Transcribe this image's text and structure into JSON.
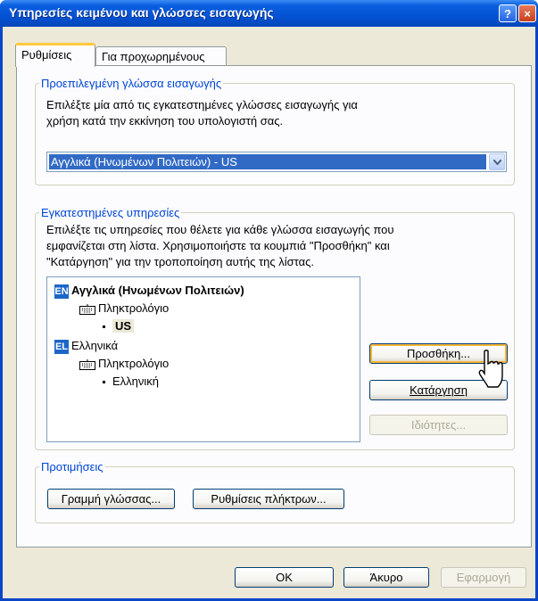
{
  "window": {
    "title": "Υπηρεσίες κειμένου και γλώσσες εισαγωγής",
    "help_label": "?",
    "close_label": "×"
  },
  "tabs": [
    {
      "label": "Ρυθμίσεις"
    },
    {
      "label": "Για προχωρημένους"
    }
  ],
  "default_language": {
    "legend": "Προεπιλεγμένη γλώσσα εισαγωγής",
    "description_line1": "Επιλέξτε μία από τις εγκατεστημένες γλώσσες εισαγωγής για",
    "description_line2": "χρήση κατά την εκκίνηση του υπολογιστή σας.",
    "selected_value": "Αγγλικά (Ηνωμένων Πολιτειών) - US"
  },
  "installed_services": {
    "legend": "Εγκατεστημένες υπηρεσίες",
    "description_line1": "Επιλέξτε τις υπηρεσίες που θέλετε για κάθε γλώσσα εισαγωγής που",
    "description_line2": "εμφανίζεται στη λίστα. Χρησιμοποιήστε τα κουμπιά \"Προσθήκη\" και",
    "description_line3": "\"Κατάργηση\" για την τροποποίηση αυτής της λίστας.",
    "tree": {
      "lang1": {
        "badge": "EN",
        "label": "Αγγλικά (Ηνωμένων Πολιτειών)",
        "category": "Πληκτρολόγιο",
        "layout": "US"
      },
      "lang2": {
        "badge": "EL",
        "label": "Ελληνικά",
        "category": "Πληκτρολόγιο",
        "layout": "Ελληνική"
      }
    },
    "buttons": {
      "add": "Προσθήκη...",
      "remove": "Κατάργηση",
      "properties": "Ιδιότητες..."
    }
  },
  "preferences": {
    "legend": "Προτιμήσεις",
    "language_bar_button": "Γραμμή γλώσσας...",
    "key_settings_button": "Ρυθμίσεις πλήκτρων..."
  },
  "footer": {
    "ok": "OK",
    "cancel": "Άκυρο",
    "apply": "Εφαρμογή"
  },
  "colors": {
    "titlebar": "#0452d4",
    "dialog_bg": "#ece9d8",
    "legend_text": "#0046d5",
    "selection": "#316ac5"
  }
}
